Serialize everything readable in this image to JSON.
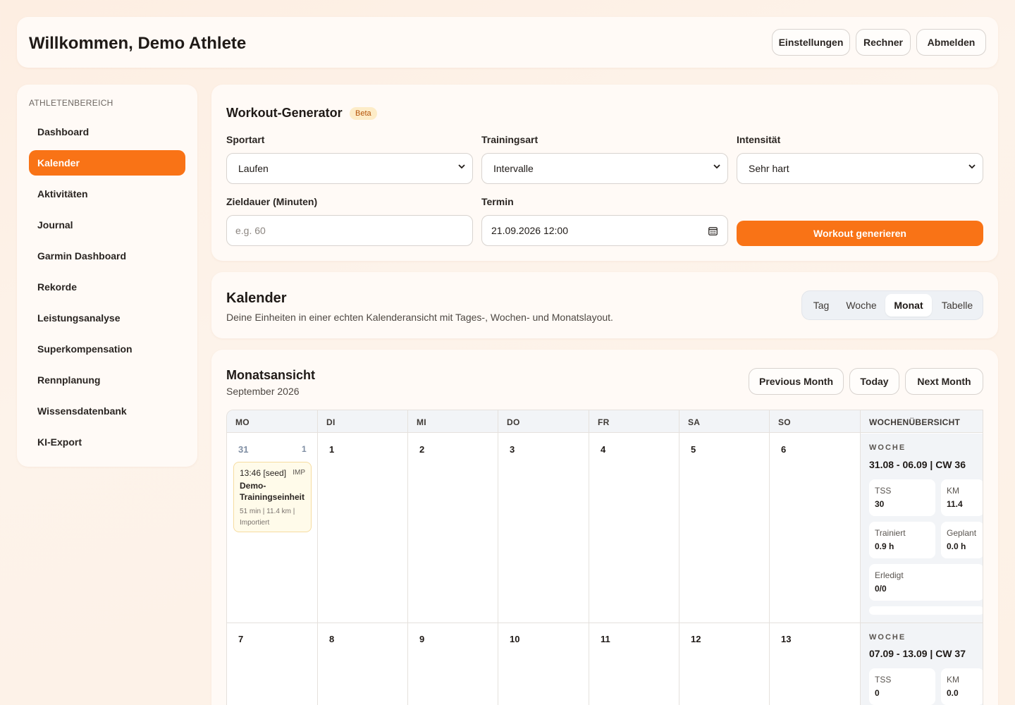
{
  "header": {
    "title": "Willkommen, Demo Athlete",
    "buttons": [
      "Einstellungen",
      "Rechner",
      "Abmelden"
    ]
  },
  "sidebar": {
    "section": "ATHLETENBEREICH",
    "items": [
      {
        "label": "Dashboard"
      },
      {
        "label": "Kalender",
        "active": true
      },
      {
        "label": "Aktivitäten"
      },
      {
        "label": "Journal"
      },
      {
        "label": "Garmin Dashboard"
      },
      {
        "label": "Rekorde"
      },
      {
        "label": "Leistungsanalyse"
      },
      {
        "label": "Superkompensation"
      },
      {
        "label": "Rennplanung"
      },
      {
        "label": "Wissensdatenbank"
      },
      {
        "label": "KI-Export"
      }
    ]
  },
  "generator": {
    "title": "Workout-Generator",
    "badge": "Beta",
    "sportart": {
      "label": "Sportart",
      "value": "Laufen"
    },
    "trainingsart": {
      "label": "Trainingsart",
      "value": "Intervalle"
    },
    "intensitaet": {
      "label": "Intensität",
      "value": "Sehr hart"
    },
    "zieldauer": {
      "label": "Zieldauer (Minuten)",
      "placeholder": "e.g. 60",
      "value": ""
    },
    "termin": {
      "label": "Termin",
      "value": "21.09.2026 12:00"
    },
    "button": "Workout generieren"
  },
  "kalender": {
    "title": "Kalender",
    "subtitle": "Deine Einheiten in einer echten Kalenderansicht mit Tages-, Wochen- und Monatslayout.",
    "views": [
      "Tag",
      "Woche",
      "Monat",
      "Tabelle"
    ],
    "active_view": "Monat"
  },
  "month": {
    "title": "Monatsansicht",
    "subtitle": "September 2026",
    "buttons": {
      "prev": "Previous Month",
      "today": "Today",
      "next": "Next Month"
    },
    "day_names": [
      "MO",
      "DI",
      "MI",
      "DO",
      "FR",
      "SA",
      "SO"
    ],
    "week_overview_label": "WOCHENÜBERSICHT",
    "weeks": [
      {
        "days": [
          "31",
          "1",
          "2",
          "3",
          "4",
          "5",
          "6"
        ],
        "first_day_count": "1",
        "label": "WOCHE",
        "range": "31.08 - 06.09 | CW 36",
        "stats": {
          "tss": {
            "label": "TSS",
            "value": "30"
          },
          "km": {
            "label": "KM",
            "value": "11.4"
          },
          "trainiert": {
            "label": "Trainiert",
            "value": "0.9 h"
          },
          "geplant": {
            "label": "Geplant",
            "value": "0.0 h"
          },
          "erledigt": {
            "label": "Erledigt",
            "value": "0/0"
          }
        }
      },
      {
        "days": [
          "7",
          "8",
          "9",
          "10",
          "11",
          "12",
          "13"
        ],
        "label": "WOCHE",
        "range": "07.09 - 13.09 | CW 37",
        "stats": {
          "tss": {
            "label": "TSS",
            "value": "0"
          },
          "km": {
            "label": "KM",
            "value": "0.0"
          }
        }
      }
    ],
    "event": {
      "time": "13:46 [seed]",
      "tag": "IMP",
      "name": "Demo-Trainingseinheit",
      "meta": "51 min | 11.4 km | Importiert"
    }
  },
  "colors": {
    "accent": "#f97316",
    "beta_bg": "#fdecc8",
    "event_bg": "#fffbea"
  }
}
